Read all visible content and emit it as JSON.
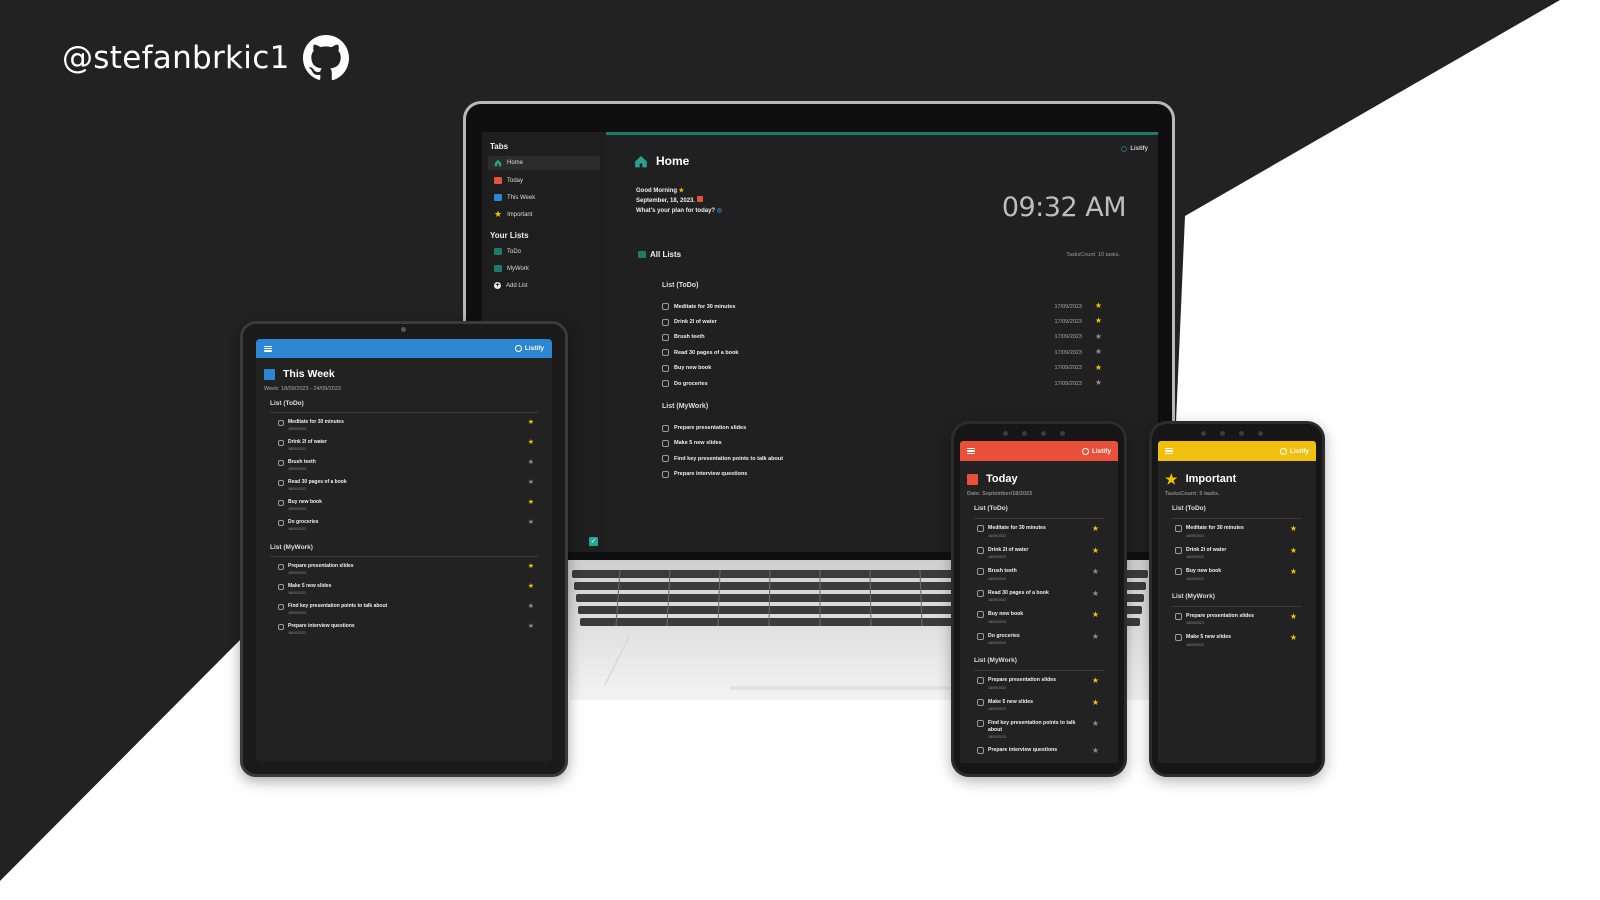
{
  "handle": {
    "text": "@stefanbrkic1",
    "icon": "github-icon"
  },
  "colors": {
    "background_dark": "#222222",
    "laptop_accent": "#1f7a6c",
    "tablet_bar": "#2c86d1",
    "today_bar": "#e8503a",
    "important_bar": "#f1bf0e",
    "star_on": "#f2c200",
    "star_off": "#8d8d8d"
  },
  "brand": "Listify",
  "laptop": {
    "sidebar": {
      "tabs_heading": "Tabs",
      "tabs": [
        {
          "label": "Home",
          "icon": "home-icon",
          "color": "#28a38b"
        },
        {
          "label": "Today",
          "icon": "calendar-icon",
          "color": "#e8503a"
        },
        {
          "label": "This Week",
          "icon": "calendar-week-icon",
          "color": "#2c86d1"
        },
        {
          "label": "Important",
          "icon": "star-icon",
          "color": "#f2c200"
        }
      ],
      "lists_heading": "Your Lists",
      "lists": [
        {
          "label": "ToDo",
          "icon": "list-icon"
        },
        {
          "label": "MyWork",
          "icon": "list-icon"
        },
        {
          "label": "Add List",
          "icon": "plus-icon"
        }
      ]
    },
    "title": "Home",
    "greeting": {
      "line1": "Good Morning",
      "line2": "September, 18, 2023.",
      "line3": "What's your plan for today?"
    },
    "clock": "09:32 AM",
    "all_lists_title": "All Lists",
    "task_count": "TasksCount: 10 tasks.",
    "lists": [
      {
        "heading": "List (ToDo)",
        "tasks": [
          {
            "title": "Meditate for 30 minutes",
            "date": "17/09/2023",
            "important": true
          },
          {
            "title": "Drink 2l of water",
            "date": "17/09/2023",
            "important": true
          },
          {
            "title": "Brush teeth",
            "date": "17/09/2023",
            "important": false
          },
          {
            "title": "Read 30 pages of a book",
            "date": "17/09/2023",
            "important": false
          },
          {
            "title": "Buy new book",
            "date": "17/09/2023",
            "important": true
          },
          {
            "title": "Do groceries",
            "date": "17/09/2023",
            "important": false
          }
        ]
      },
      {
        "heading": "List (MyWork)",
        "tasks": [
          {
            "title": "Prepare presentation slides"
          },
          {
            "title": "Make 5 new slides"
          },
          {
            "title": "Find key presentation points to talk about"
          },
          {
            "title": "Prepare interview questions"
          }
        ]
      }
    ]
  },
  "tablet": {
    "title": "This Week",
    "week": "Week: 18/09/2023 - 24/09/2023",
    "lists": [
      {
        "heading": "List (ToDo)",
        "tasks": [
          {
            "title": "Meditate for 30 minutes",
            "date": "18/09/2023",
            "important": true
          },
          {
            "title": "Drink 2l of water",
            "date": "18/09/2023",
            "important": true
          },
          {
            "title": "Brush teeth",
            "date": "18/09/2023",
            "important": false
          },
          {
            "title": "Read 30 pages of a book",
            "date": "18/09/2023",
            "important": false
          },
          {
            "title": "Buy new book",
            "date": "18/09/2023",
            "important": true
          },
          {
            "title": "Do groceries",
            "date": "18/09/2023",
            "important": false
          }
        ]
      },
      {
        "heading": "List (MyWork)",
        "tasks": [
          {
            "title": "Prepare presentation slides",
            "date": "18/09/2023",
            "important": true
          },
          {
            "title": "Make 5 new slides",
            "date": "18/09/2023",
            "important": true
          },
          {
            "title": "Find key presentation points to talk about",
            "date": "18/09/2023",
            "important": false
          },
          {
            "title": "Prepare interview questions",
            "date": "18/09/2023",
            "important": false
          }
        ]
      }
    ]
  },
  "phone_today": {
    "title": "Today",
    "subtitle": "Date: September/18/2023",
    "lists": [
      {
        "heading": "List (ToDo)",
        "tasks": [
          {
            "title": "Meditate for 30 minutes",
            "date": "18/09/2023",
            "important": true
          },
          {
            "title": "Drink 2l of water",
            "date": "18/09/2023",
            "important": true
          },
          {
            "title": "Brush teeth",
            "date": "18/09/2023",
            "important": false
          },
          {
            "title": "Read 30 pages of a book",
            "date": "18/09/2023",
            "important": false
          },
          {
            "title": "Buy new book",
            "date": "18/09/2023",
            "important": true
          },
          {
            "title": "Do groceries",
            "date": "18/09/2023",
            "important": false
          }
        ]
      },
      {
        "heading": "List (MyWork)",
        "tasks": [
          {
            "title": "Prepare presentation slides",
            "date": "18/09/2023",
            "important": true
          },
          {
            "title": "Make 5 new slides",
            "date": "18/09/2023",
            "important": true
          },
          {
            "title": "Find key presentation points to talk about",
            "date": "18/09/2023",
            "important": false
          },
          {
            "title": "Prepare interview questions",
            "date": "",
            "important": false
          }
        ]
      }
    ]
  },
  "phone_important": {
    "title": "Important",
    "subtitle": "TasksCount: 5 tasks.",
    "lists": [
      {
        "heading": "List (ToDo)",
        "tasks": [
          {
            "title": "Meditate for 30 minutes",
            "date": "18/09/2023",
            "important": true
          },
          {
            "title": "Drink 2l of water",
            "date": "18/09/2023",
            "important": true
          },
          {
            "title": "Buy new book",
            "date": "18/09/2023",
            "important": true
          }
        ]
      },
      {
        "heading": "List (MyWork)",
        "tasks": [
          {
            "title": "Prepare presentation slides",
            "date": "18/09/2023",
            "important": true
          },
          {
            "title": "Make 5 new slides",
            "date": "18/09/2023",
            "important": true
          }
        ]
      }
    ]
  }
}
